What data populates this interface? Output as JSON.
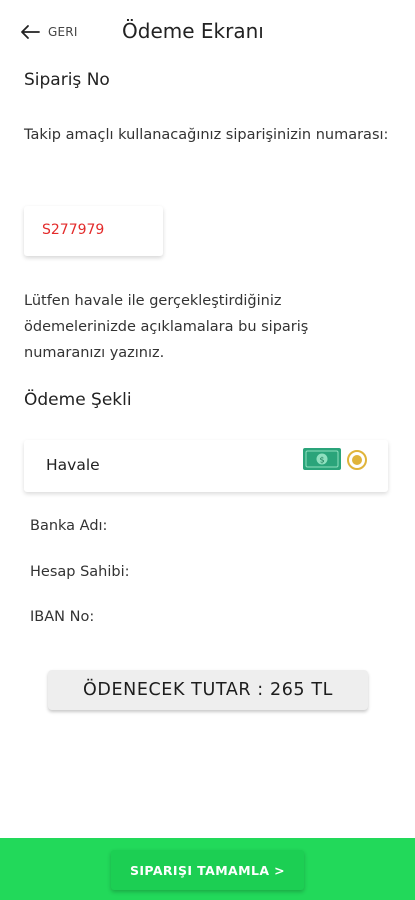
{
  "header": {
    "back_label": "GERI",
    "title": "Ödeme Ekranı"
  },
  "order": {
    "section_title": "Sipariş No",
    "description": "Takip amaçlı kullanacağınız siparişinizin numarası:",
    "number": "S277979",
    "number_color": "#e32b2b",
    "note": "Lütfen havale ile gerçekleştirdiğiniz ödemelerinizde açıklamalara bu sipariş numaranızı yazınız."
  },
  "payment": {
    "section_title": "Ödeme Şekli",
    "method_label": "Havale",
    "method_icon": "money-icon",
    "selected": true,
    "radio_color": "#e0b43a"
  },
  "bank_info": {
    "bank_name_label": "Banka Adı:",
    "account_holder_label": "Hesap Sahibi:",
    "iban_label": "IBAN No:"
  },
  "total": {
    "label": "ÖDENECEK TUTAR : 265 TL"
  },
  "footer": {
    "complete_label": "SIPARIŞI TAMAMLA >",
    "background_color": "#22d95a"
  }
}
